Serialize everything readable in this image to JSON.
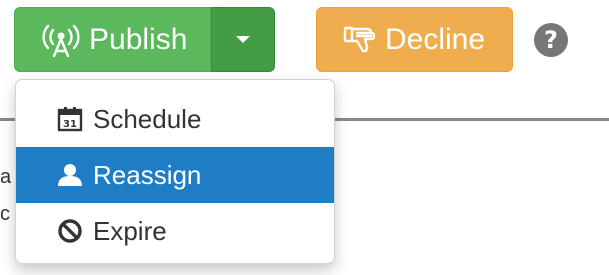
{
  "toolbar": {
    "publish_label": "Publish",
    "decline_label": "Decline",
    "help_symbol": "?"
  },
  "icons": {
    "publish": "broadcast-tower-icon",
    "dropdown": "caret-down-icon",
    "decline": "thumbs-down-icon",
    "help": "question-circle-icon",
    "schedule": "calendar-icon",
    "reassign": "user-icon",
    "expire": "ban-icon"
  },
  "dropdown_menu": {
    "items": [
      {
        "label": "Schedule",
        "active": false
      },
      {
        "label": "Reassign",
        "active": true
      },
      {
        "label": "Expire",
        "active": false
      }
    ]
  },
  "background_fragments": [
    "a",
    "c"
  ],
  "colors": {
    "publish": "#5cb85c",
    "publish_caret": "#449d44",
    "decline": "#f0ad4e",
    "help": "#777777",
    "menu_active": "#1f7dc6"
  }
}
